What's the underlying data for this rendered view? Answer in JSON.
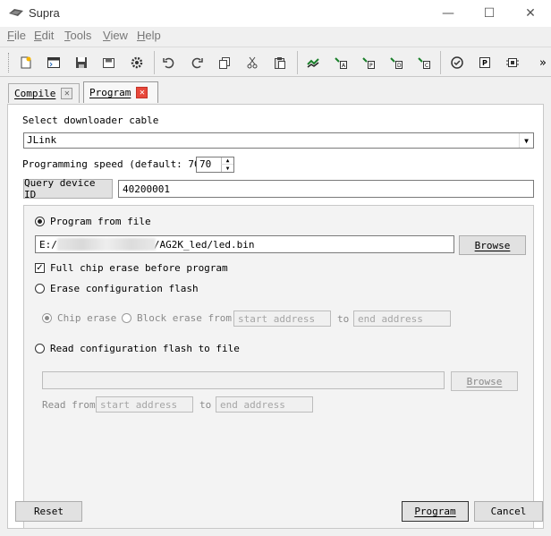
{
  "window": {
    "title": "Supra",
    "minimize": "—",
    "maximize": "☐",
    "close": "✕"
  },
  "menu": [
    "File",
    "Edit",
    "Tools",
    "View",
    "Help"
  ],
  "menu_mnemonics": [
    "F",
    "E",
    "T",
    "V",
    "H"
  ],
  "toolbar": {
    "icons": [
      "new-file-icon",
      "terminal-icon",
      "save-icon",
      "save-all-icon",
      "settings-icon",
      "undo-icon",
      "redo-icon",
      "copy-icon",
      "cut-icon",
      "paste-icon",
      "compile-all-icon",
      "compile-a-icon",
      "compile-p-icon",
      "compile-d-icon",
      "compile-c-icon",
      "check-icon",
      "program-icon",
      "chip-icon"
    ],
    "overflow": "»"
  },
  "tabs": [
    {
      "label": "Compile",
      "mnemonic": "C"
    },
    {
      "label": "Program",
      "mnemonic": "P"
    }
  ],
  "program": {
    "cable_label": "Select downloader cable",
    "cable_value": "JLink",
    "speed_label": "Programming speed (default: 70)",
    "speed_value": "70",
    "query_button": "Query device ID",
    "device_id": "40200001",
    "program_from_file": "Program from file",
    "file_path_prefix": "E:/",
    "file_path_suffix": "/AG2K_led/led.bin",
    "browse_label": "Browse",
    "full_chip_erase": "Full chip erase before program",
    "erase_config_flash": "Erase configuration flash",
    "chip_erase": "Chip erase",
    "block_erase_from": "Block erase from",
    "start_address_placeholder": "start address",
    "to_label": "to",
    "end_address_placeholder": "end address",
    "read_config_flash": "Read configuration flash to file",
    "read_browse_label": "Browse",
    "read_from_label": "Read from",
    "read_start_placeholder": "start address",
    "read_to_label": "to",
    "read_end_placeholder": "end address"
  },
  "footer": {
    "reset": "Reset",
    "program": "Program",
    "cancel": "Cancel"
  }
}
